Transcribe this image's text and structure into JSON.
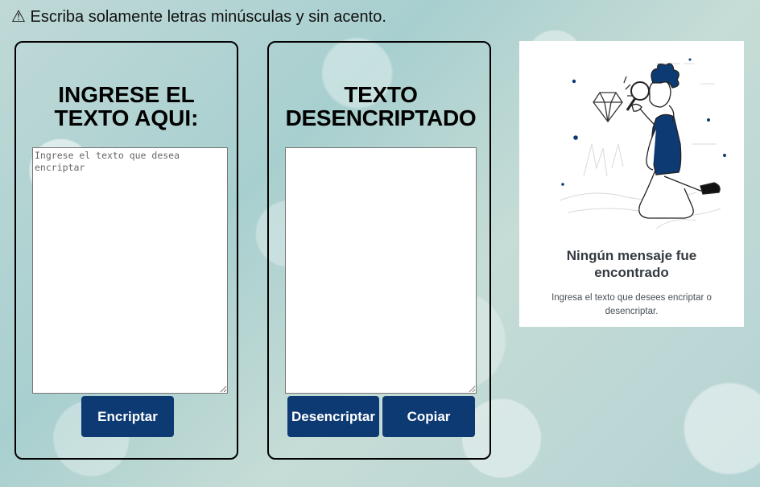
{
  "warning": {
    "icon": "warning-icon",
    "text": "⚠ Escriba solamente letras minúsculas y sin acento."
  },
  "encrypt_panel": {
    "title": "INGRESE EL\nTEXTO AQUI:",
    "textarea_placeholder": "Ingrese el texto que desea encriptar",
    "textarea_value": "",
    "button_label": "Encriptar"
  },
  "decrypt_panel": {
    "title": "TEXTO\nDESENCRIPTADO",
    "textarea_value": "",
    "decrypt_button_label": "Desencriptar",
    "copy_button_label": "Copiar"
  },
  "result_card": {
    "illustration": "person-with-magnifying-glass-illustration",
    "title": "Ningún mensaje fue\nencontrado",
    "subtitle": "Ingresa el texto que desees encriptar o\ndesencriptar."
  },
  "colors": {
    "button_bg": "#0d3a73",
    "button_text": "#ffffff",
    "panel_border": "#000000",
    "illustration_accent": "#0d3a73"
  }
}
